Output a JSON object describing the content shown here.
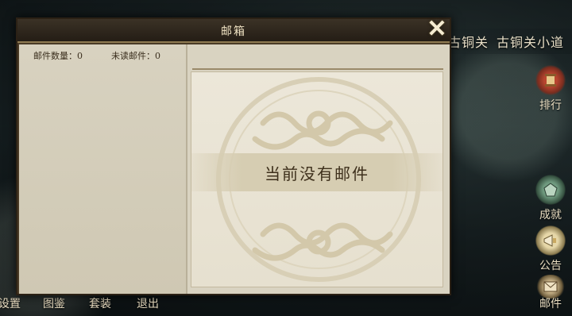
{
  "background": {
    "location": [
      "古铜关",
      "古铜关小道"
    ],
    "side_buttons": [
      {
        "label": "排行",
        "icon": "rank-scroll-icon"
      },
      {
        "label": "成就",
        "icon": "achievement-icon"
      },
      {
        "label": "公告",
        "icon": "announcement-icon"
      },
      {
        "label": "邮件",
        "icon": "mail-icon"
      }
    ],
    "bottom_buttons": [
      {
        "label": "设置",
        "icon": "settings-icon"
      },
      {
        "label": "图鉴",
        "icon": "codex-icon"
      },
      {
        "label": "套装",
        "icon": "outfit-icon"
      },
      {
        "label": "退出",
        "icon": "exit-icon"
      }
    ]
  },
  "mailbox": {
    "title": "邮箱",
    "close_icon": "close-icon",
    "mail_count_label": "邮件数量：0",
    "unread_count_label": "未读邮件：0",
    "empty_message": "当前没有邮件",
    "emblem_icon": "dragon-medallion-icon"
  },
  "colors": {
    "frame": "#4a3b26",
    "parchment": "#d9d3c1",
    "title_text": "#efe2c2",
    "body_text": "#3a2e1d"
  }
}
